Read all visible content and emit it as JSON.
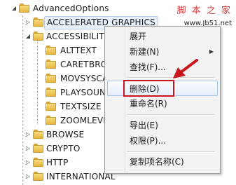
{
  "tree": {
    "root": "AdvancedOptions",
    "items": [
      {
        "label": "ACCELERATED GRAPHICS",
        "expander": "▷"
      },
      {
        "label": "ACCESSIBILITY",
        "expander": "◢"
      },
      {
        "label": "ALTTEXT"
      },
      {
        "label": "CARETBRO"
      },
      {
        "label": "MOVSYSCA"
      },
      {
        "label": "PLAYSOUN"
      },
      {
        "label": "TEXTSIZE"
      },
      {
        "label": "ZOOMLEVE"
      },
      {
        "label": "BROWSE",
        "expander": "▷"
      },
      {
        "label": "CRYPTO",
        "expander": "▷"
      },
      {
        "label": "HTTP",
        "expander": "▷"
      },
      {
        "label": "INTERNATIONAL",
        "expander": "▷"
      }
    ]
  },
  "watermark": {
    "line1": "脚 本 之 家",
    "line2": "www.Jb51.net"
  },
  "context_menu": {
    "items": [
      {
        "label": "展开"
      },
      {
        "label": "新建(N)",
        "submenu_arrow": "▶"
      },
      {
        "label": "查找(F)..."
      },
      {
        "label": "删除(D)",
        "highlighted": true
      },
      {
        "label": "重命名(R)"
      },
      {
        "label": "导出(E)"
      },
      {
        "label": "权限(P)..."
      },
      {
        "label": "复制项名称(C)"
      }
    ]
  },
  "colors": {
    "highlight_box": "#c8161d",
    "arrow": "#c8161d",
    "folder": "#e6b645",
    "selection": "#e8f1fb"
  }
}
